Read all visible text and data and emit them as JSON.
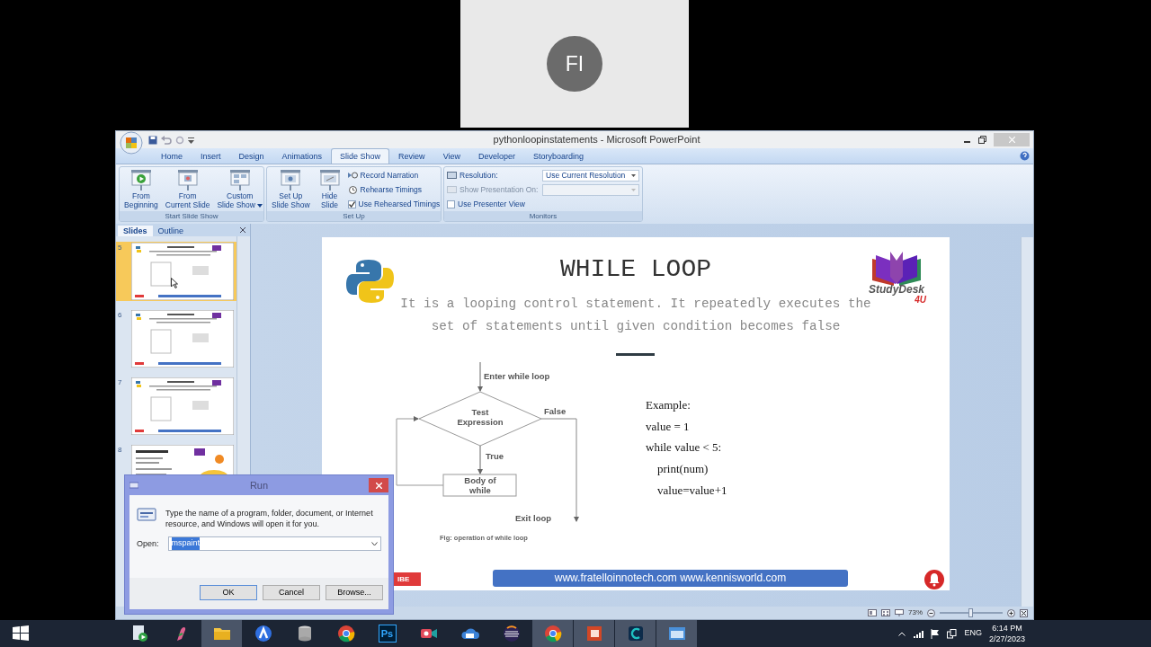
{
  "meeting_tile": {
    "initials": "FI"
  },
  "window": {
    "title": "pythonloopinstatements - Microsoft PowerPoint"
  },
  "ribbon_tabs": [
    {
      "label": "Home",
      "selected": false
    },
    {
      "label": "Insert",
      "selected": false
    },
    {
      "label": "Design",
      "selected": false
    },
    {
      "label": "Animations",
      "selected": false
    },
    {
      "label": "Slide Show",
      "selected": true
    },
    {
      "label": "Review",
      "selected": false
    },
    {
      "label": "View",
      "selected": false
    },
    {
      "label": "Developer",
      "selected": false
    },
    {
      "label": "Storyboarding",
      "selected": false
    }
  ],
  "start_group": {
    "label": "Start Slide Show",
    "buttons": [
      {
        "kind": "play",
        "label": "From\nBeginning",
        "menu": false
      },
      {
        "kind": "screen",
        "label": "From\nCurrent Slide",
        "menu": false
      },
      {
        "kind": "custom",
        "label": "Custom\nSlide Show",
        "menu": true
      }
    ]
  },
  "setup_group": {
    "label": "Set Up",
    "buttons": [
      {
        "kind": "setup",
        "label": "Set Up\nSlide Show"
      },
      {
        "kind": "hide",
        "label": "Hide\nSlide"
      }
    ],
    "items": [
      {
        "kind": "narration",
        "label": "Record Narration"
      },
      {
        "kind": "timing",
        "label": "Rehearse Timings"
      },
      {
        "kind": "check",
        "label": "Use Rehearsed Timings",
        "checked": true
      }
    ]
  },
  "monitors_group": {
    "label": "Monitors",
    "rows": [
      {
        "kind": "dropdown",
        "label": "Resolution:",
        "value": "Use Current Resolution",
        "disabled": false
      },
      {
        "kind": "dropdown",
        "label": "Show Presentation On:",
        "disabled": true
      },
      {
        "kind": "checkbox",
        "label": "Use Presenter View",
        "checked": false
      }
    ]
  },
  "slides_pane": {
    "tabs": [
      {
        "label": "Slides",
        "selected": true
      },
      {
        "label": "Outline",
        "selected": false
      }
    ],
    "thumbnails": [
      {
        "number": "5",
        "selected": true,
        "kind": "flowchart"
      },
      {
        "number": "6",
        "selected": false,
        "kind": "flowchart"
      },
      {
        "number": "7",
        "selected": false,
        "kind": "flowchart"
      },
      {
        "number": "8",
        "selected": false,
        "kind": "closing"
      }
    ]
  },
  "slide": {
    "title": "WHILE LOOP",
    "subtitle": "It is a looping control statement. It repeatedly executes the set of statements until given condition becomes false",
    "logo": {
      "name": "StudyDesk",
      "tag": "4U"
    },
    "flowchart": {
      "entry": "Enter while loop",
      "condition_lines": [
        "Test",
        "Expression"
      ],
      "false_label": "False",
      "true_label": "True",
      "body_lines": [
        "Body of",
        "while"
      ],
      "exit": "Exit loop",
      "caption": "Fig: operation of while loop"
    },
    "code": [
      {
        "text": "Example:"
      },
      {
        "text": "value = 1"
      },
      {
        "text": "while value < 5:",
        "children": [
          {
            "text": "print(num)"
          },
          {
            "text": "value=value+1"
          }
        ]
      }
    ],
    "subscribe_fragment": "IBE",
    "footer": "www.fratelloinnotech.com www.kennisworld.com"
  },
  "status_bar": {
    "zoom": {
      "reading": "73%",
      "level": 0.5
    }
  },
  "run_dialog": {
    "title": "Run",
    "message": "Type the name of a program, folder, document, or Internet resource, and Windows will open it for you.",
    "open_label": "Open:",
    "open_value": "mspaint",
    "value_selected": true,
    "buttons": [
      "OK",
      "Cancel",
      "Browse..."
    ]
  },
  "taskbar": {
    "apps": [
      {
        "kind": "start",
        "active": false
      },
      {
        "kind": "media",
        "active": false
      },
      {
        "kind": "quill",
        "active": false
      },
      {
        "kind": "folder",
        "active": true
      },
      {
        "kind": "round",
        "active": false
      },
      {
        "kind": "database",
        "active": false
      },
      {
        "kind": "browser",
        "active": false
      },
      {
        "kind": "text",
        "label": "Ps",
        "active": false
      },
      {
        "kind": "camera",
        "active": false
      },
      {
        "kind": "cloud",
        "active": false
      },
      {
        "kind": "striped",
        "active": false
      },
      {
        "kind": "browser",
        "active": true
      },
      {
        "kind": "presentation",
        "active": true
      },
      {
        "kind": "tile",
        "active": true
      },
      {
        "kind": "window",
        "active": true
      }
    ],
    "language": "ENG",
    "time": "6:14 PM",
    "date": "2/27/2023"
  }
}
